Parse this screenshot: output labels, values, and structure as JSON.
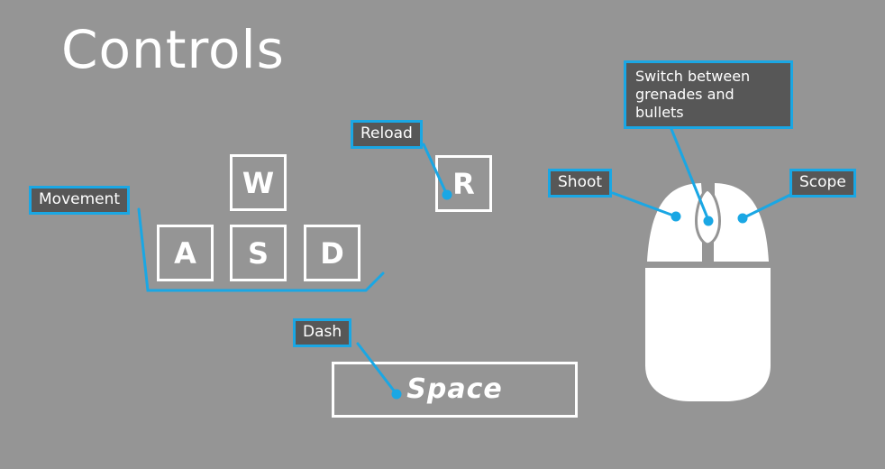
{
  "title": "Controls",
  "keys": {
    "w": "W",
    "a": "A",
    "s": "S",
    "d": "D",
    "r": "R",
    "space": "Space"
  },
  "labels": {
    "movement": "Movement",
    "reload": "Reload",
    "dash": "Dash",
    "shoot": "Shoot",
    "scope": "Scope",
    "switch": "Switch between grenades and bullets"
  },
  "colors": {
    "background": "#959595",
    "accent": "#1aa7e4",
    "label_bg": "#575757",
    "key_outline": "#ffffff"
  },
  "icons": {
    "mouse": "computer-mouse-icon"
  }
}
